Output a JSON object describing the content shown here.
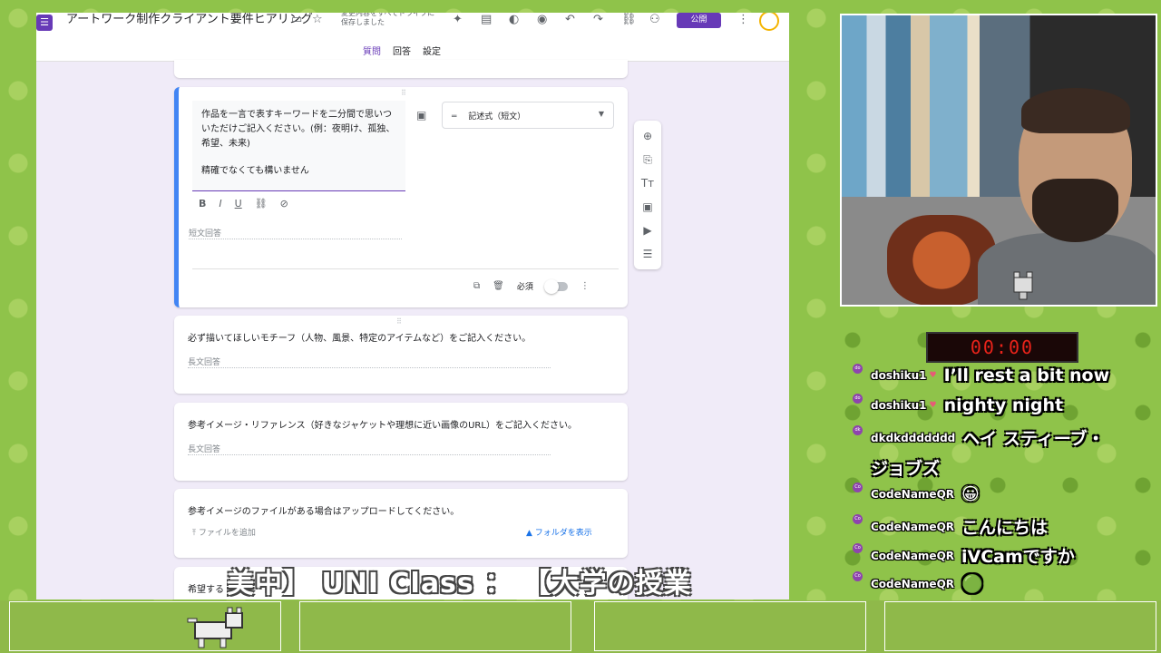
{
  "forms": {
    "title": "アートワーク制作クライアント要件ヒアリング",
    "save_status": "変更内容をすべてドライブに保存しました",
    "publish_label": "公開",
    "tabs": [
      "質問",
      "回答",
      "設定"
    ],
    "active_question": {
      "text_line1": "作品を一言で表すキーワードを二分間で思いついただけご記入ください。(例：夜明け、孤独、希望、未来)",
      "text_line2": "精確でなくても構いません",
      "format_buttons": [
        "B",
        "I",
        "U",
        "⛓",
        "⊘"
      ],
      "answer_placeholder": "短文回答",
      "type_lead": "═",
      "type_label": "記述式（短文）",
      "required_label": "必須"
    },
    "questions": [
      {
        "title": "必ず描いてほしいモチーフ（人物、風景、特定のアイテムなど）をご記入ください。",
        "answer": "長文回答"
      },
      {
        "title": "参考イメージ・リファレンス（好きなジャケットや理想に近い画像のURL）をご記入ください。",
        "answer": "長文回答"
      },
      {
        "title": "参考イメージのファイルがある場合はアップロードしてください。",
        "upload_label": "⤒  ファイルを追加",
        "folder_label": "▲  フォルダを表示"
      },
      {
        "title": "希望する"
      }
    ]
  },
  "timer": "00:00",
  "chat": [
    {
      "user": "doshiku1",
      "heart": true,
      "message": "I’ll rest a bit now"
    },
    {
      "user": "doshiku1",
      "heart": true,
      "message": "nighty night"
    },
    {
      "user": "dkdkddddddd",
      "heart": false,
      "message": "ヘイ スティーブ・"
    },
    {
      "user": "",
      "heart": false,
      "message": "ジョブズ"
    },
    {
      "user": "CodeNameQR",
      "heart": false,
      "message": "😀"
    },
    {
      "user": "CodeNameQR",
      "heart": false,
      "message": "こんにちは"
    },
    {
      "user": "CodeNameQR",
      "heart": false,
      "message": "iVCamですか"
    },
    {
      "user": "CodeNameQR",
      "heart": false,
      "message": "🟢"
    }
  ],
  "ticker": "美中】  UNI Class  ：  【大学の授業",
  "colors": {
    "accent": "#673ab7",
    "active_border": "#4285f4",
    "timer": "#e8231a",
    "background": "#8fc34a"
  }
}
